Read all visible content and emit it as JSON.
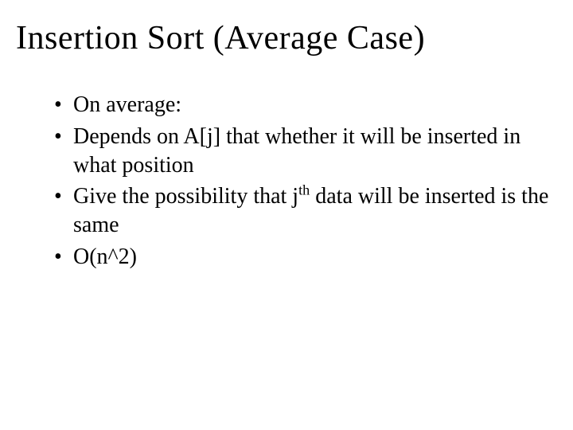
{
  "title": "Insertion Sort (Average Case)",
  "bullets": {
    "b1": "On average:",
    "b2_pre": "Depends on A[j] that whether it will be inserted in what position",
    "b3_pre": "Give the possibility that j",
    "b3_sup": "th",
    "b3_post": " data will be inserted is the same",
    "b4": "O(n^2)"
  }
}
